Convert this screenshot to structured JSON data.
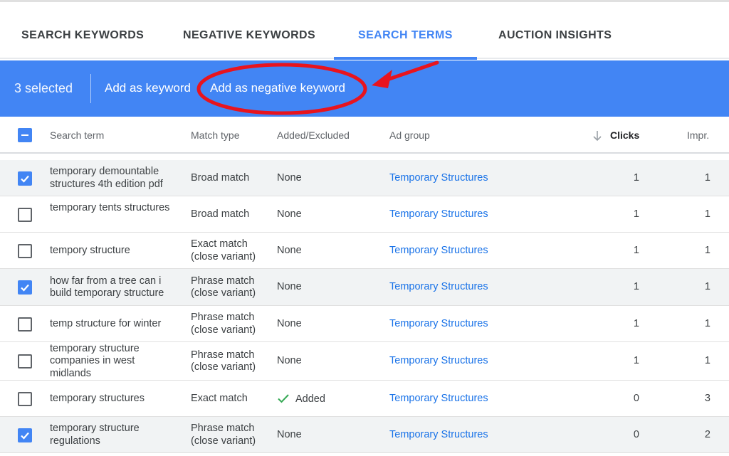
{
  "tabs": [
    {
      "label": "SEARCH KEYWORDS",
      "active": false
    },
    {
      "label": "NEGATIVE KEYWORDS",
      "active": false
    },
    {
      "label": "SEARCH TERMS",
      "active": true
    },
    {
      "label": "AUCTION INSIGHTS",
      "active": false
    }
  ],
  "action_bar": {
    "selected_text": "3 selected",
    "add_keyword": "Add as keyword",
    "add_negative_keyword": "Add as negative keyword"
  },
  "table": {
    "columns": {
      "search_term": "Search term",
      "match_type": "Match type",
      "added_excluded": "Added/Excluded",
      "ad_group": "Ad group",
      "clicks": "Clicks",
      "impr": "Impr."
    },
    "rows": [
      {
        "checked": true,
        "term": "temporary demountable structures 4th edition pdf",
        "match": "Broad match",
        "added": "None",
        "ad_group": "Temporary Structures",
        "clicks": "1",
        "impr": "1"
      },
      {
        "checked": false,
        "term": "temporary tents structures",
        "match": "Broad match",
        "added": "None",
        "ad_group": "Temporary Structures",
        "clicks": "1",
        "impr": "1"
      },
      {
        "checked": false,
        "term": "tempory structure",
        "match": "Exact match (close variant)",
        "added": "None",
        "ad_group": "Temporary Structures",
        "clicks": "1",
        "impr": "1"
      },
      {
        "checked": true,
        "term": "how far from a tree can i build temporary structure",
        "match": "Phrase match (close variant)",
        "added": "None",
        "ad_group": "Temporary Structures",
        "clicks": "1",
        "impr": "1"
      },
      {
        "checked": false,
        "term": "temp structure for winter",
        "match": "Phrase match (close variant)",
        "added": "None",
        "ad_group": "Temporary Structures",
        "clicks": "1",
        "impr": "1"
      },
      {
        "checked": false,
        "term": "temporary structure companies in west midlands",
        "match": "Phrase match (close variant)",
        "added": "None",
        "ad_group": "Temporary Structures",
        "clicks": "1",
        "impr": "1"
      },
      {
        "checked": false,
        "term": "temporary structures",
        "match": "Exact match",
        "added": "Added",
        "ad_group": "Temporary Structures",
        "clicks": "0",
        "impr": "3"
      },
      {
        "checked": true,
        "term": "temporary structure regulations",
        "match": "Phrase match (close variant)",
        "added": "None",
        "ad_group": "Temporary Structures",
        "clicks": "0",
        "impr": "2"
      }
    ]
  },
  "colors": {
    "accent": "#4285f4",
    "link": "#1a73e8",
    "annotation": "#e8141e",
    "added_check": "#34a853"
  }
}
